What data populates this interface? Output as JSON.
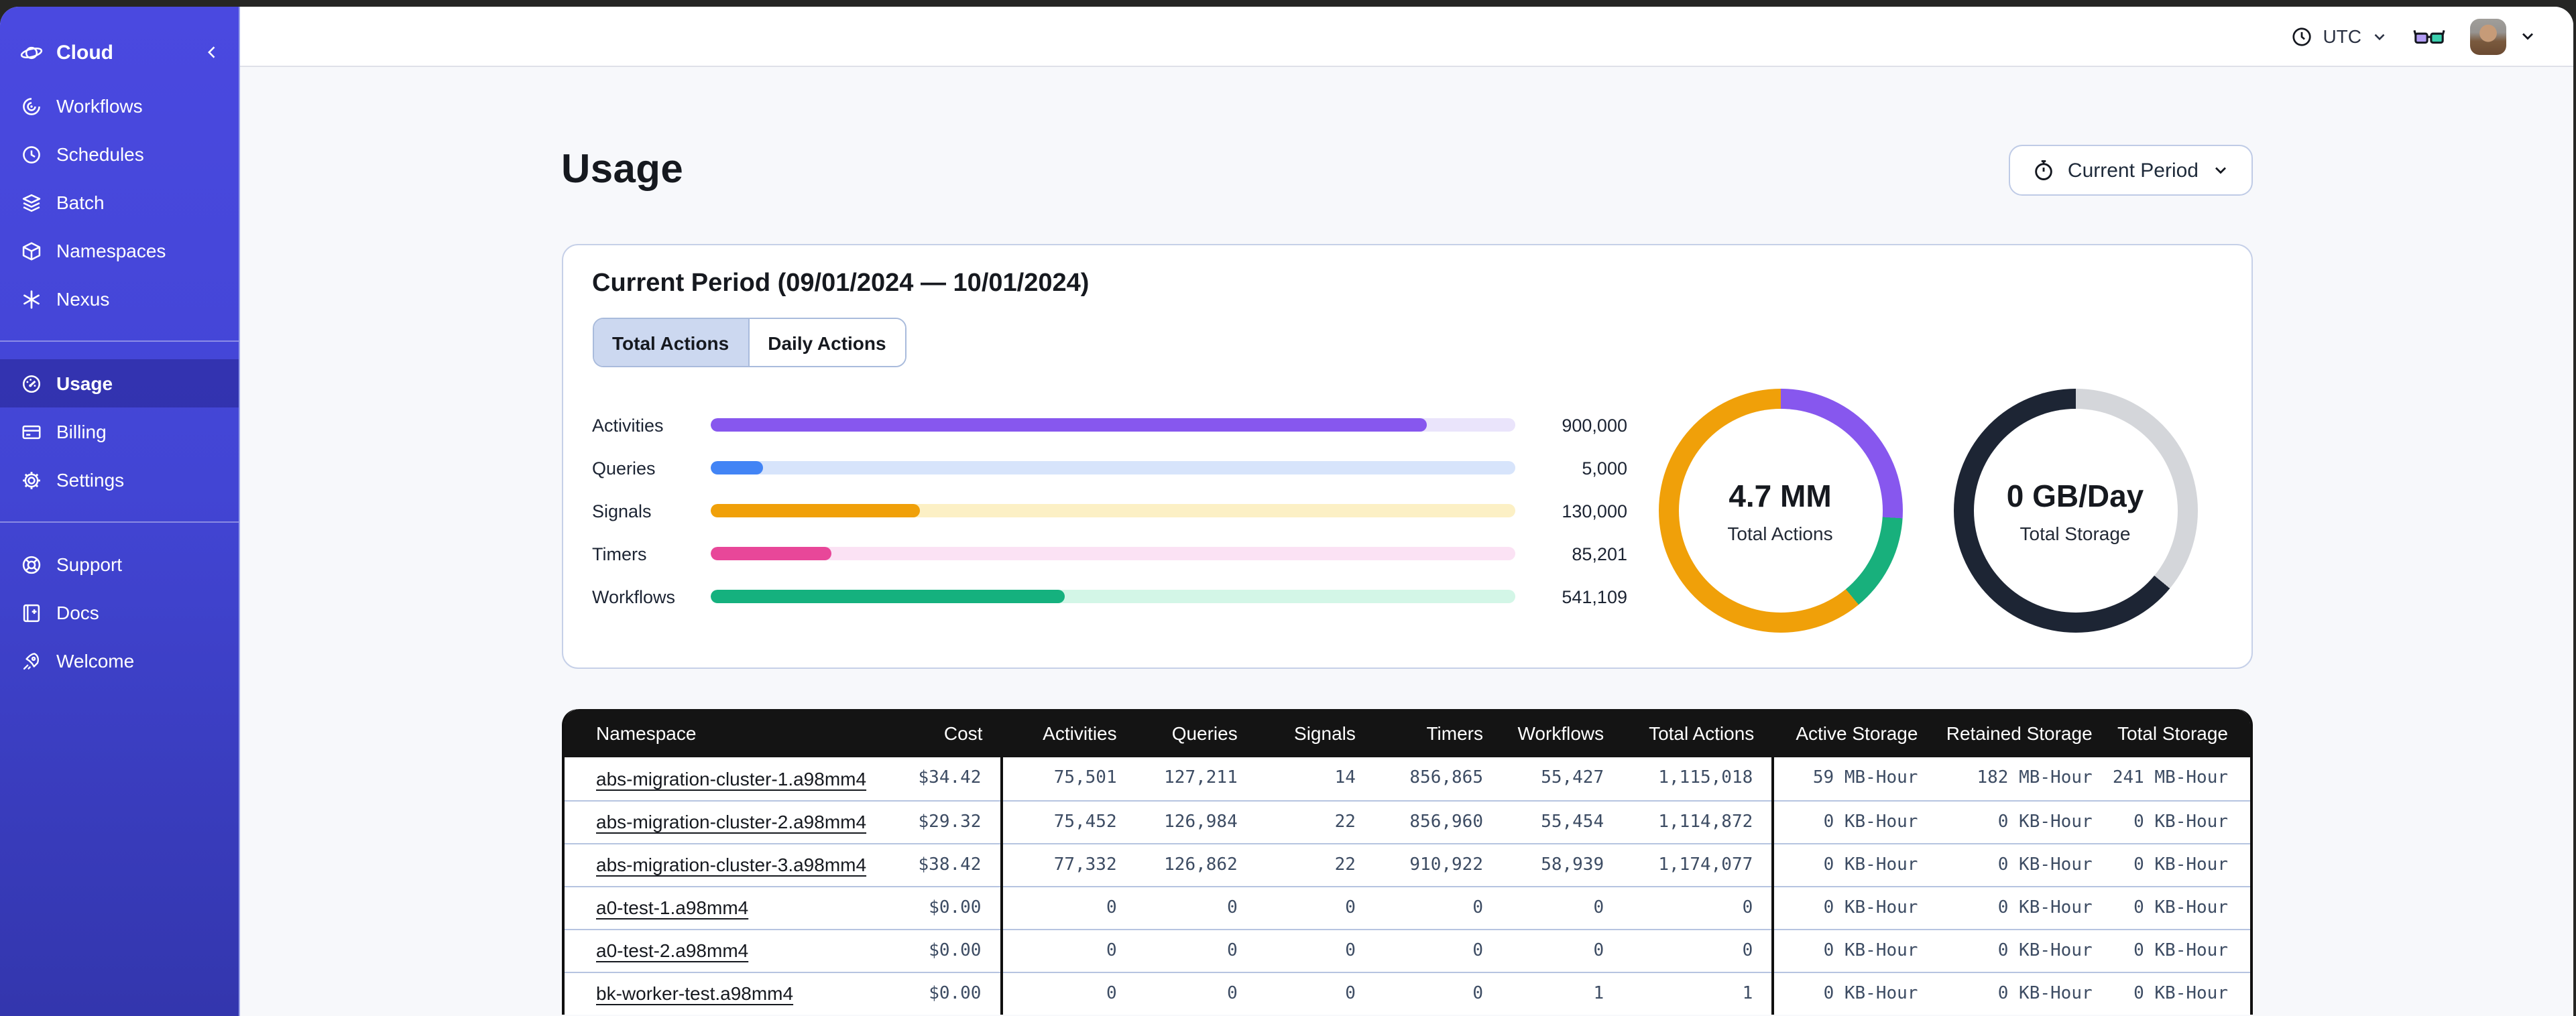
{
  "topbar": {
    "timezone": "UTC"
  },
  "sidebar": {
    "brand": "Cloud",
    "primary": [
      {
        "label": "Workflows"
      },
      {
        "label": "Schedules"
      },
      {
        "label": "Batch"
      },
      {
        "label": "Namespaces"
      },
      {
        "label": "Nexus"
      }
    ],
    "account": [
      {
        "label": "Usage",
        "active": true
      },
      {
        "label": "Billing"
      },
      {
        "label": "Settings"
      }
    ],
    "footer": [
      {
        "label": "Support"
      },
      {
        "label": "Docs"
      },
      {
        "label": "Welcome"
      }
    ]
  },
  "page": {
    "title": "Usage",
    "period_button_label": "Current Period"
  },
  "card": {
    "title": "Current Period (09/01/2024 — 10/01/2024)",
    "tabs": [
      {
        "label": "Total Actions",
        "selected": true
      },
      {
        "label": "Daily Actions",
        "selected": false
      }
    ]
  },
  "chart_data": [
    {
      "type": "bar",
      "orientation": "horizontal",
      "categories": [
        "Activities",
        "Queries",
        "Signals",
        "Timers",
        "Workflows"
      ],
      "values": [
        900000,
        5000,
        130000,
        85201,
        541109
      ],
      "display_values": [
        "900,000",
        "5,000",
        "130,000",
        "85,201",
        "541,109"
      ],
      "fill_percent": [
        89,
        6.5,
        26,
        15,
        44
      ],
      "colors": [
        "#8757ee",
        "#4284f5",
        "#f0a009",
        "#e84799",
        "#15b17e"
      ],
      "track_colors": [
        "#eae4fb",
        "#d7e4fb",
        "#fcf0c5",
        "#fbe2f4",
        "#d3f6e7"
      ],
      "axis": "hidden"
    },
    {
      "type": "pie",
      "subtype": "donut",
      "label": "4.7 MM",
      "sublabel": "Total Actions",
      "segments": [
        {
          "name": "activities",
          "color": "#8757ee",
          "pct": 26
        },
        {
          "name": "workflows",
          "color": "#18b07c",
          "pct": 13
        },
        {
          "name": "signals",
          "color": "#f0a009",
          "pct": 61
        }
      ]
    },
    {
      "type": "pie",
      "subtype": "donut",
      "label": "0 GB/Day",
      "sublabel": "Total Storage",
      "segments": [
        {
          "name": "free",
          "color": "#d4d6da",
          "pct": 36
        },
        {
          "name": "used",
          "color": "#1d2534",
          "pct": 64
        }
      ]
    }
  ],
  "table": {
    "columns": [
      "Namespace",
      "Cost",
      "Activities",
      "Queries",
      "Signals",
      "Timers",
      "Workflows",
      "Total Actions",
      "Active Storage",
      "Retained Storage",
      "Total Storage"
    ],
    "rows": [
      [
        "abs-migration-cluster-1.a98mm4",
        "$34.42",
        "75,501",
        "127,211",
        "14",
        "856,865",
        "55,427",
        "1,115,018",
        "59 MB-Hour",
        "182 MB-Hour",
        "241 MB-Hour"
      ],
      [
        "abs-migration-cluster-2.a98mm4",
        "$29.32",
        "75,452",
        "126,984",
        "22",
        "856,960",
        "55,454",
        "1,114,872",
        "0 KB-Hour",
        "0 KB-Hour",
        "0 KB-Hour"
      ],
      [
        "abs-migration-cluster-3.a98mm4",
        "$38.42",
        "77,332",
        "126,862",
        "22",
        "910,922",
        "58,939",
        "1,174,077",
        "0 KB-Hour",
        "0 KB-Hour",
        "0 KB-Hour"
      ],
      [
        "a0-test-1.a98mm4",
        "$0.00",
        "0",
        "0",
        "0",
        "0",
        "0",
        "0",
        "0 KB-Hour",
        "0 KB-Hour",
        "0 KB-Hour"
      ],
      [
        "a0-test-2.a98mm4",
        "$0.00",
        "0",
        "0",
        "0",
        "0",
        "0",
        "0",
        "0 KB-Hour",
        "0 KB-Hour",
        "0 KB-Hour"
      ],
      [
        "bk-worker-test.a98mm4",
        "$0.00",
        "0",
        "0",
        "0",
        "0",
        "1",
        "1",
        "0 KB-Hour",
        "0 KB-Hour",
        "0 KB-Hour"
      ]
    ]
  }
}
